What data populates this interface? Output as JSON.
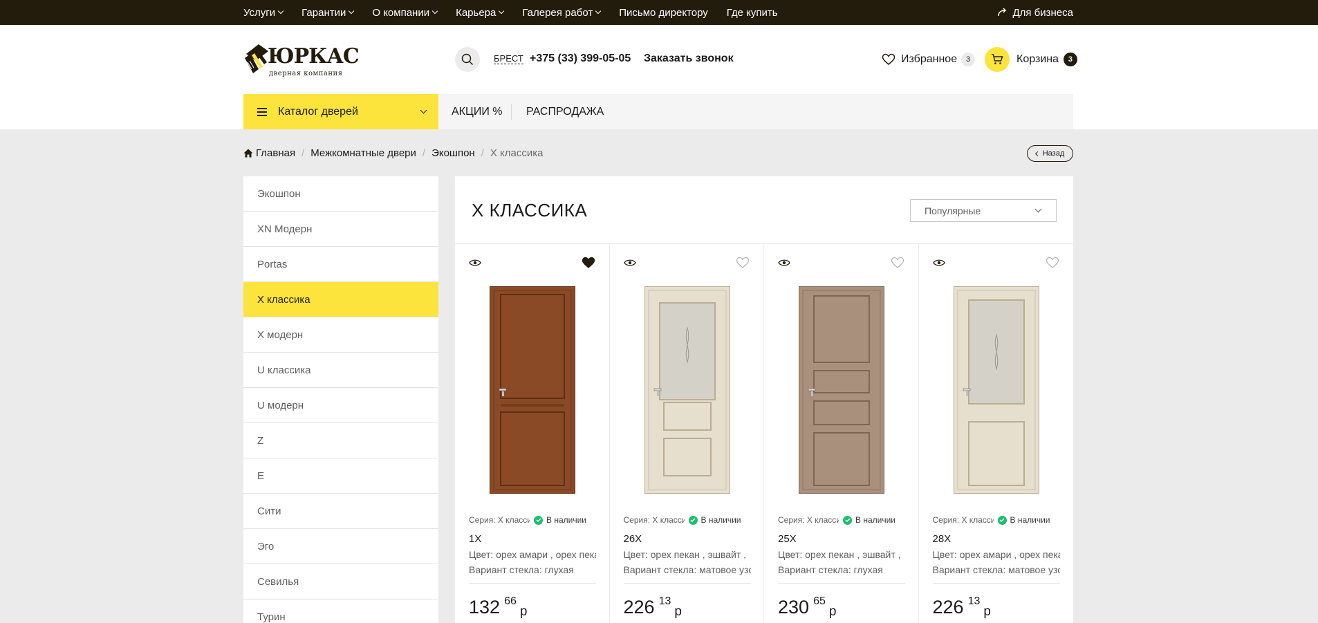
{
  "topbar": {
    "items": [
      {
        "label": "Услуги",
        "dropdown": true
      },
      {
        "label": "Гарантии",
        "dropdown": true
      },
      {
        "label": "О компании",
        "dropdown": true
      },
      {
        "label": "Карьера",
        "dropdown": true
      },
      {
        "label": "Галерея работ",
        "dropdown": true
      },
      {
        "label": "Письмо директору",
        "dropdown": false
      },
      {
        "label": "Где купить",
        "dropdown": false
      }
    ],
    "business_label": "Для бизнеса"
  },
  "header": {
    "logo_name": "ЮРКАС",
    "logo_subtitle": "дверная компания",
    "city": "БРЕСТ",
    "phone": "+375 (33) 399-05-05",
    "callback_label": "Заказать звонок",
    "favorites_label": "Избранное",
    "favorites_count": "3",
    "cart_label": "Корзина",
    "cart_count": "3"
  },
  "navbar": {
    "catalog_label": "Каталог дверей",
    "links": [
      "АКЦИИ %",
      "РАСПРОДАЖА"
    ]
  },
  "breadcrumb": {
    "items": [
      "Главная",
      "Межкомнатные двери",
      "Экошпон"
    ],
    "current": "X классика",
    "back_label": "Назад"
  },
  "sidebar": {
    "items": [
      "Экошпон",
      "XN Модерн",
      "Portas",
      "X классика",
      "X модерн",
      "U классика",
      "U модерн",
      "Z",
      "E",
      "Сити",
      "Эго",
      "Севилья",
      "Турин"
    ],
    "active_index": 3
  },
  "catalog": {
    "title": "X КЛАССИКА",
    "sort_selected": "Популярные",
    "products": [
      {
        "series": "Серия: X классика",
        "stock": "В наличии",
        "model": "1X",
        "color": "Цвет: орех амари , орех пекан",
        "glass": "Вариант стекла: глухая",
        "price_rub": "132",
        "price_kop": "66",
        "currency": "р",
        "favorite": true,
        "door_color": "#8a4a25",
        "door_style": "solid"
      },
      {
        "series": "Серия: X классика",
        "stock": "В наличии",
        "model": "26X",
        "color": "Цвет: орех пекан , эшвайт , ",
        "glass": "Вариант стекла: матовое узор",
        "price_rub": "226",
        "price_kop": "13",
        "currency": "р",
        "favorite": false,
        "door_color": "#e6dfcd",
        "door_style": "glass"
      },
      {
        "series": "Серия: X классика",
        "stock": "В наличии",
        "model": "25X",
        "color": "Цвет: орех пекан , эшвайт , ",
        "glass": "Вариант стекла: глухая",
        "price_rub": "230",
        "price_kop": "65",
        "currency": "р",
        "favorite": false,
        "door_color": "#a8907c",
        "door_style": "panels"
      },
      {
        "series": "Серия: X классика",
        "stock": "В наличии",
        "model": "28X",
        "color": "Цвет: орех амари , орех пекан",
        "glass": "Вариант стекла: матовое узор",
        "price_rub": "226",
        "price_kop": "13",
        "currency": "р",
        "favorite": false,
        "door_color": "#e6dfcd",
        "door_style": "glass2"
      }
    ]
  },
  "colors": {
    "accent": "#fce43c",
    "topbar_bg": "#231c0d",
    "in_stock": "#1ebd6f"
  }
}
